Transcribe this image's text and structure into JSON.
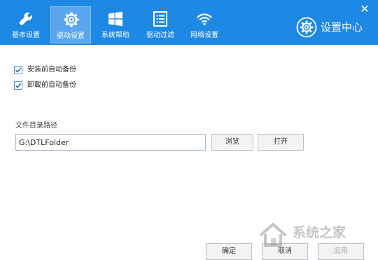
{
  "window": {
    "close_glyph": "✕",
    "brand_title": "设置中心",
    "header_color": "#1e88e5"
  },
  "tabs": [
    {
      "label": "基本设置",
      "icon": "wrench-icon",
      "active": false
    },
    {
      "label": "驱动设置",
      "icon": "gear-icon",
      "active": true
    },
    {
      "label": "系统帮助",
      "icon": "windows-logo-icon",
      "active": false
    },
    {
      "label": "驱动过滤",
      "icon": "list-icon",
      "active": false
    },
    {
      "label": "网络设置",
      "icon": "wifi-icon",
      "active": false
    }
  ],
  "options": {
    "backup_before_install": {
      "label": "安装前自动备份",
      "checked": true
    },
    "backup_before_uninstall": {
      "label": "卸載前自动备份",
      "checked": true
    }
  },
  "directory": {
    "label": "文件目录路径",
    "path": "G:\\DTLFolder",
    "browse_label": "浏览",
    "open_label": "打开"
  },
  "footer": {
    "ok_label": "确定",
    "cancel_label": "取消",
    "apply_label": "应用"
  },
  "watermark": {
    "text": "系统之家"
  }
}
